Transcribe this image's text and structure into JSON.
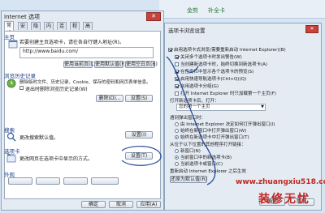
{
  "background": {
    "tabs": [
      "金剪",
      "补全卡"
    ]
  },
  "internet_options": {
    "title": "Internet 选项",
    "close": "✕",
    "tabs": [
      "常规",
      "安全",
      "隐私",
      "内容",
      "连接",
      "程序",
      "高级"
    ],
    "home": {
      "heading": "主页",
      "desc": "若要创建主页选项卡，请在各自行键入地址(R)。",
      "url": "http://www.baidu.com/",
      "buttons": [
        "使用当前页(C)",
        "使用默认值(F)",
        "使用空白页(B)"
      ]
    },
    "history": {
      "heading": "浏览历史记录",
      "desc": "删除临时文件、历史记录、Cookie、保存的密码和网页表单信息。",
      "checkbox": "退出时删除浏览历史记录(W)",
      "buttons": [
        "删除(D)...",
        "设置(S)"
      ]
    },
    "search": {
      "heading": "搜索",
      "desc": "更改搜索默认值。",
      "button": "设置(I)"
    },
    "tabs_section": {
      "heading": "选项卡",
      "desc": "更改网页在选项卡中显示的方式。",
      "button": "设置(T)"
    },
    "appearance": {
      "heading": "外观"
    },
    "footer": [
      "确定",
      "取消",
      "应用(A)"
    ]
  },
  "tab_settings": {
    "title": "选项卡浏览设置",
    "close": "✕",
    "checkboxes": [
      {
        "label": "启用选项卡式浏览(需要重新启动 Internet Explorer)(B)",
        "checked": true
      },
      {
        "label": "关闭多个选项卡时发出警告(W)",
        "checked": true
      },
      {
        "label": "当创建新选项卡时，始终切换到新选项卡(A)",
        "checked": false
      },
      {
        "label": "在任务栏中显示各个选项卡的预览(S)",
        "checked": true
      },
      {
        "label": "启用快速导航选项卡(Ctrl+Q)(Q)",
        "checked": true
      },
      {
        "label": "启用选项卡分组(G)",
        "checked": true
      }
    ],
    "newtab_label": "打开 Internet Explorer 时只加载第一个主页(F)",
    "newtab_open_label": "打开新选项卡后，打开：",
    "newtab_select": "您的第一个主页",
    "popup_heading": "遇到弹出窗口时：",
    "popup_options": [
      {
        "label": "由 Internet Explorer 决定如何打开弹出窗口(I)",
        "on": false
      },
      {
        "label": "始终在新窗口中打开弹出窗口(W)",
        "on": false
      },
      {
        "label": "始终在新选项卡中打开弹出窗口(T)",
        "on": true
      }
    ],
    "links_heading": "从位于以下位置的其他程序打开链接：",
    "links_options": [
      {
        "label": "新窗口(N)",
        "on": false
      },
      {
        "label": "当前窗口中的新选项卡(B)",
        "on": true
      },
      {
        "label": "当前选项卡或窗口(C)",
        "on": false
      }
    ],
    "footer_label": "重新启动 Internet Explorer 之后生效",
    "buttons": [
      "还原为默认值(R)",
      "确定",
      "取消"
    ]
  },
  "watermark": {
    "url": "www.zhuangxiu518.com",
    "name": "装修无忧"
  },
  "colors": {
    "ink": "#2a4a9a",
    "watermark": "#c0261f",
    "close": "#c8423b"
  }
}
